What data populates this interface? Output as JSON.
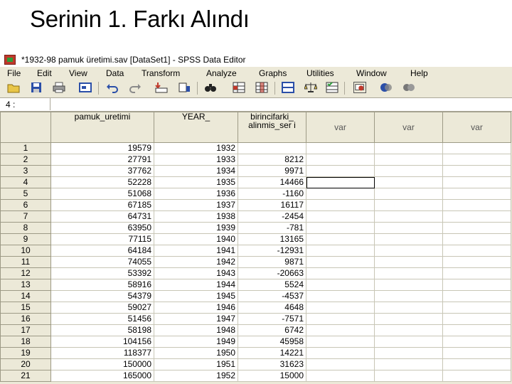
{
  "slide": {
    "title": "Serinin 1. Farkı Alındı"
  },
  "window": {
    "title": "*1932-98 pamuk üretimi.sav [DataSet1] - SPSS Data Editor"
  },
  "menu": [
    "File",
    "Edit",
    "View",
    "Data",
    "Transform",
    "Analyze",
    "Graphs",
    "Utilities",
    "Window",
    "Help"
  ],
  "cellbar": {
    "ref": "4 :"
  },
  "grid": {
    "columns": [
      "pamuk_uretimi",
      "YEAR_",
      "birincifarki_ alinmis_ser i",
      "var",
      "var",
      "var"
    ],
    "rows": [
      [
        "1",
        "19579",
        "1932",
        ""
      ],
      [
        "2",
        "27791",
        "1933",
        "8212"
      ],
      [
        "3",
        "37762",
        "1934",
        "9971"
      ],
      [
        "4",
        "52228",
        "1935",
        "14466"
      ],
      [
        "5",
        "51068",
        "1936",
        "-1160"
      ],
      [
        "6",
        "67185",
        "1937",
        "16117"
      ],
      [
        "7",
        "64731",
        "1938",
        "-2454"
      ],
      [
        "8",
        "63950",
        "1939",
        "-781"
      ],
      [
        "9",
        "77115",
        "1940",
        "13165"
      ],
      [
        "10",
        "64184",
        "1941",
        "-12931"
      ],
      [
        "11",
        "74055",
        "1942",
        "9871"
      ],
      [
        "12",
        "53392",
        "1943",
        "-20663"
      ],
      [
        "13",
        "58916",
        "1944",
        "5524"
      ],
      [
        "14",
        "54379",
        "1945",
        "-4537"
      ],
      [
        "15",
        "59027",
        "1946",
        "4648"
      ],
      [
        "16",
        "51456",
        "1947",
        "-7571"
      ],
      [
        "17",
        "58198",
        "1948",
        "6742"
      ],
      [
        "18",
        "104156",
        "1949",
        "45958"
      ],
      [
        "19",
        "118377",
        "1950",
        "14221"
      ],
      [
        "20",
        "150000",
        "1951",
        "31623"
      ],
      [
        "21",
        "165000",
        "1952",
        "15000"
      ]
    ],
    "selected_row": 4
  }
}
